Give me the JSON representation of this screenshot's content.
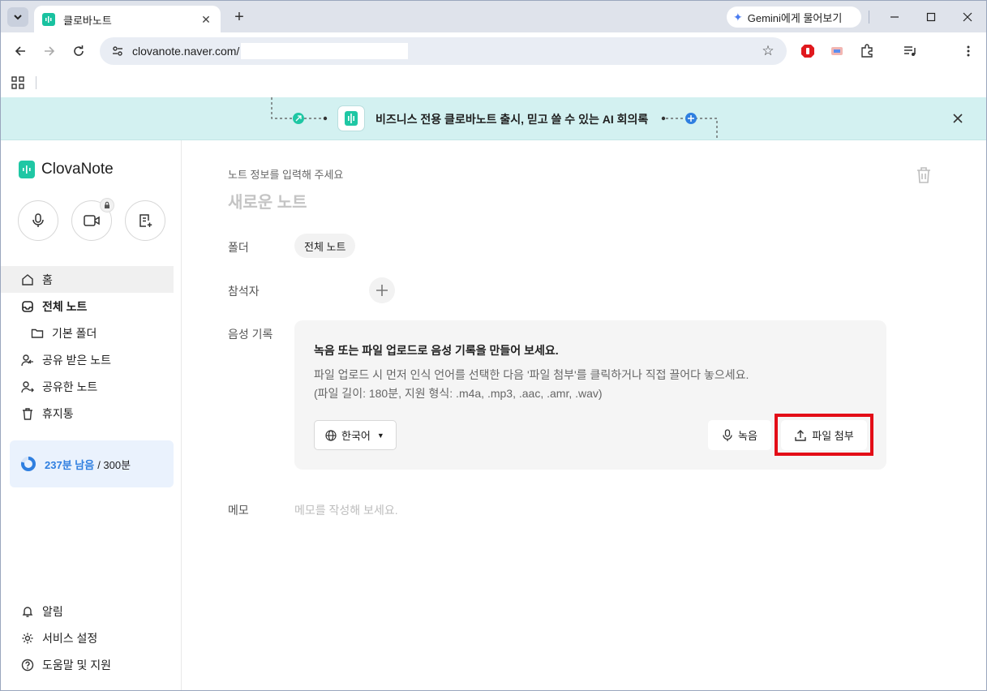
{
  "browser": {
    "tab_title": "클로바노트",
    "gemini_label": "Gemini에게 물어보기",
    "url": "clovanote.naver.com/"
  },
  "banner": {
    "text": "비즈니스 전용 클로바노트 출시, 믿고 쓸 수 있는 AI 회의록"
  },
  "sidebar": {
    "logo": "ClovaNote",
    "nav": {
      "home": "홈",
      "all_notes": "전체 노트",
      "default_folder": "기본 폴더",
      "shared_with_me": "공유 받은 노트",
      "shared_by_me": "공유한 노트",
      "trash": "휴지통"
    },
    "quota": {
      "remaining": "237분 남음",
      "total": "/ 300분",
      "used_fraction": 0.21
    },
    "bottom": {
      "alerts": "알림",
      "settings": "서비스 설정",
      "help": "도움말 및 지원"
    }
  },
  "note": {
    "hint": "노트 정보를 입력해 주세요",
    "title_placeholder": "새로운 노트",
    "folder_label": "폴더",
    "folder_value": "전체 노트",
    "participants_label": "참석자",
    "audio_label": "음성 기록",
    "audio_title": "녹음 또는 파일 업로드로 음성 기록을 만들어 보세요.",
    "audio_desc_line1": "파일 업로드 시 먼저 인식 언어를 선택한 다음 '파일 첨부'를 클릭하거나 직접 끌어다 놓으세요.",
    "audio_desc_line2": "(파일 길이: 180분, 지원 형식: .m4a, .mp3, .aac, .amr, .wav)",
    "language": "한국어",
    "record_button": "녹음",
    "attach_button": "파일 첨부",
    "memo_label": "메모",
    "memo_placeholder": "메모를 작성해 보세요."
  },
  "colors": {
    "accent": "#1fc7a4",
    "highlight": "#e30d17",
    "quota_blue": "#2f7fe0",
    "banner_bg": "#d3f1f1"
  }
}
